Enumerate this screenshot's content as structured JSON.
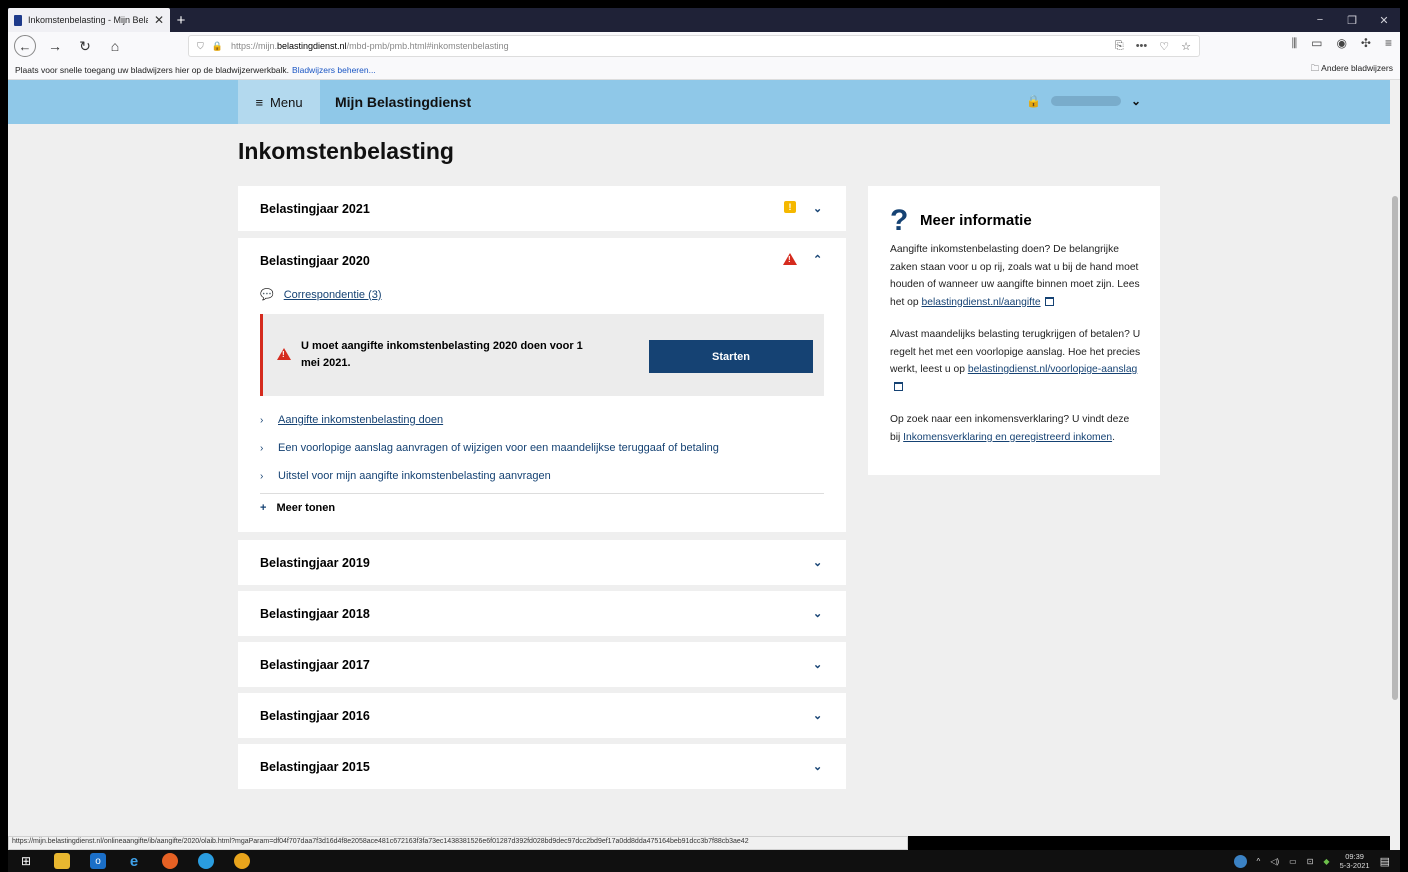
{
  "browser": {
    "tab_title": "Inkomstenbelasting - Mijn Bela",
    "tab_close": "✕",
    "new_tab": "+",
    "window_controls": [
      "−",
      "❐",
      "✕"
    ],
    "url_prefix": "https://mijn.",
    "url_host": "belastingdienst.nl",
    "url_path": "/mbd-pmb/pmb.html#inkomstenbelasting",
    "url_actions": [
      "⎘",
      "•••",
      "♡",
      "☆"
    ],
    "toolbar_right": [
      "⫼",
      "▭",
      "◉",
      "✣",
      "≡"
    ],
    "bookmarks_text": "Plaats voor snelle toegang uw bladwijzers hier op de bladwijzerwerkbalk.",
    "bookmarks_link": "Bladwijzers beheren...",
    "other_bookmarks": "Andere bladwijzers",
    "status_url": "https://mijn.belastingdienst.nl/onlineaangifte/ib/aangifte/2020/olaib.html?mgaParam=df04f707daa7f3d16d4f8e2058ace481c672163f3fa73ec1438381526e6f01287d392fd028bd9dec97dcc2bd9ef17a0dd8dda475164beb91dcc3b7f88cb3ae42"
  },
  "header": {
    "menu_icon": "≡",
    "menu_label": "Menu",
    "brand": "Mijn Belastingdienst",
    "lock_icon": "🔒",
    "user_caret": "⌄"
  },
  "page": {
    "title": "Inkomstenbelasting"
  },
  "years": [
    {
      "label": "Belastingjaar 2021",
      "status": "warning"
    },
    {
      "label": "Belastingjaar 2020",
      "status": "alert",
      "expanded": true
    },
    {
      "label": "Belastingjaar 2019"
    },
    {
      "label": "Belastingjaar 2018"
    },
    {
      "label": "Belastingjaar 2017"
    },
    {
      "label": "Belastingjaar 2016"
    },
    {
      "label": "Belastingjaar 2015"
    }
  ],
  "year2020": {
    "correspondence_icon": "💬",
    "correspondence_label": "Correspondentie (3)",
    "alert_message": "U moet aangifte inkomstenbelasting 2020 doen voor 1 mei 2021.",
    "start_button": "Starten",
    "links": [
      "Aangifte inkomstenbelasting doen",
      "Een voorlopige aanslag aanvragen of wijzigen voor een maandelijkse teruggaaf of betaling",
      "Uitstel voor mijn aangifte inkomstenbelasting aanvragen"
    ],
    "more": "Meer tonen",
    "more_icon": "+"
  },
  "info": {
    "icon": "?",
    "title": "Meer informatie",
    "p1_text": "Aangifte inkomstenbelasting doen? De belangrijke zaken staan voor u op rij, zoals wat u bij de hand moet houden of wanneer uw aangifte binnen moet zijn. Lees het op ",
    "p1_link": "belastingdienst.nl/aangifte",
    "p2_text": "Alvast maandelijks belasting terugkrijgen of betalen? U regelt het met een voorlopige aanslag. Hoe het precies werkt, leest u op ",
    "p2_link": "belastingdienst.nl/voorlopige-aanslag",
    "p3_text": "Op zoek naar een inkomensverklaring? U vindt deze bij ",
    "p3_link": "Inkomensverklaring en geregistreerd inkomen",
    "p3_end": "."
  },
  "taskbar": {
    "clock_time": "09:39",
    "clock_date": "5-3-2021"
  },
  "colors": {
    "primary": "#154273",
    "alert": "#d52b1e",
    "warning": "#f5b800",
    "header": "#8fc8e8"
  }
}
